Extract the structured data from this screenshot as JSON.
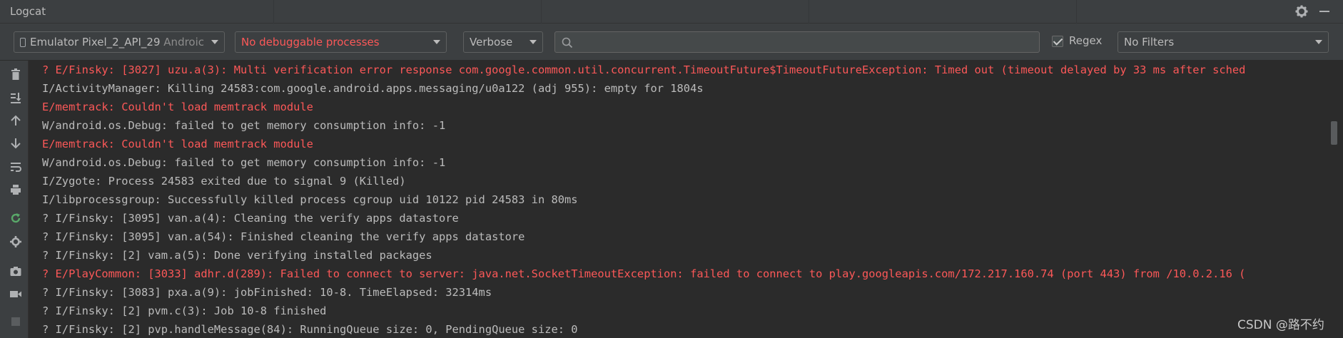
{
  "window": {
    "title": "Logcat"
  },
  "toolbar": {
    "device": {
      "main": "Emulator Pixel_2_API_29",
      "suffix": "Androic"
    },
    "process": {
      "value": "No debuggable processes",
      "color": "#fc5858"
    },
    "level": {
      "value": "Verbose"
    },
    "search": {
      "value": "",
      "placeholder": ""
    },
    "regex": {
      "label": "Regex",
      "checked": true
    },
    "filter": {
      "value": "No Filters"
    }
  },
  "sidebar": {
    "icons": [
      "trash-icon",
      "scroll-to-end-icon",
      "up-arrow-icon",
      "down-arrow-icon",
      "soft-wrap-icon",
      "print-icon",
      "restart-icon",
      "settings-icon",
      "screenshot-icon",
      "screen-record-icon",
      "stop-icon"
    ]
  },
  "log": {
    "lines": [
      {
        "level": "E",
        "text": "? E/Finsky: [3027] uzu.a(3): Multi verification error response com.google.common.util.concurrent.TimeoutFuture$TimeoutFutureException: Timed out (timeout delayed by 33 ms after sched"
      },
      {
        "level": "I",
        "text": "I/ActivityManager: Killing 24583:com.google.android.apps.messaging/u0a122 (adj 955): empty for 1804s"
      },
      {
        "level": "E",
        "text": "E/memtrack: Couldn't load memtrack module"
      },
      {
        "level": "W",
        "text": "W/android.os.Debug: failed to get memory consumption info: -1"
      },
      {
        "level": "E",
        "text": "E/memtrack: Couldn't load memtrack module"
      },
      {
        "level": "W",
        "text": "W/android.os.Debug: failed to get memory consumption info: -1"
      },
      {
        "level": "I",
        "text": "I/Zygote: Process 24583 exited due to signal 9 (Killed)"
      },
      {
        "level": "I",
        "text": "I/libprocessgroup: Successfully killed process cgroup uid 10122 pid 24583 in 80ms"
      },
      {
        "level": "I",
        "text": "? I/Finsky: [3095] van.a(4): Cleaning the verify apps datastore"
      },
      {
        "level": "I",
        "text": "? I/Finsky: [3095] van.a(54): Finished cleaning the verify apps datastore"
      },
      {
        "level": "I",
        "text": "? I/Finsky: [2] vam.a(5): Done verifying installed packages"
      },
      {
        "level": "E",
        "text": "? E/PlayCommon: [3033] adhr.d(289): Failed to connect to server: java.net.SocketTimeoutException: failed to connect to play.googleapis.com/172.217.160.74 (port 443) from /10.0.2.16 ("
      },
      {
        "level": "I",
        "text": "? I/Finsky: [3083] pxa.a(9): jobFinished: 10-8. TimeElapsed: 32314ms"
      },
      {
        "level": "I",
        "text": "? I/Finsky: [2] pvm.c(3): Job 10-8 finished"
      },
      {
        "level": "I",
        "text": "? I/Finsky: [2] pvp.handleMessage(84): RunningQueue size: 0, PendingQueue size: 0"
      }
    ]
  },
  "watermark": {
    "text": "CSDN @路不约"
  },
  "colors": {
    "error": "#fc5858",
    "normal": "#bbbbbb",
    "background": "#2b2b2b",
    "panel": "#3c3f41"
  }
}
